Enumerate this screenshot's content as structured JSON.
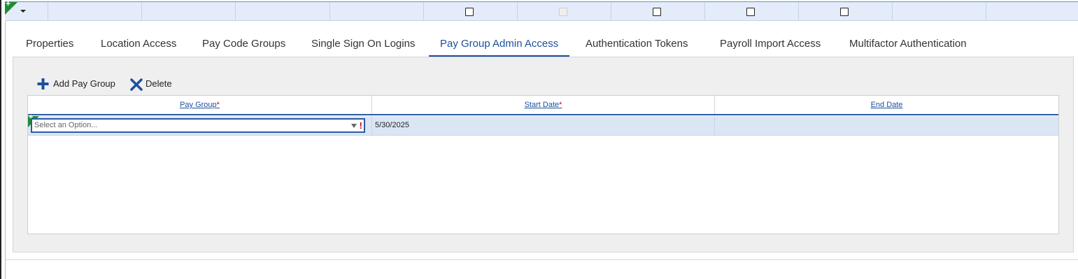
{
  "top_row": {
    "checkboxes": [
      {
        "checked": false,
        "disabled": false
      },
      {
        "checked": false,
        "disabled": true
      },
      {
        "checked": false,
        "disabled": false
      },
      {
        "checked": false,
        "disabled": false
      },
      {
        "checked": false,
        "disabled": false
      }
    ]
  },
  "tabs": [
    {
      "label": "Properties",
      "active": false
    },
    {
      "label": "Location Access",
      "active": false
    },
    {
      "label": "Pay Code Groups",
      "active": false
    },
    {
      "label": "Single Sign On Logins",
      "active": false
    },
    {
      "label": "Pay Group Admin Access",
      "active": true
    },
    {
      "label": "Authentication Tokens",
      "active": false
    },
    {
      "label": "Payroll Import Access",
      "active": false
    },
    {
      "label": "Multifactor Authentication",
      "active": false
    }
  ],
  "toolbar": {
    "add_label": "Add Pay Group",
    "delete_label": "Delete"
  },
  "grid": {
    "columns": [
      {
        "label": "Pay Group",
        "required_mark": "*"
      },
      {
        "label": "Start Date",
        "required_mark": "*"
      },
      {
        "label": "End Date",
        "required_mark": ""
      }
    ],
    "rows": [
      {
        "pay_group_placeholder": "Select an Option...",
        "pay_group_warning": "!",
        "start_date": "5/30/2025",
        "end_date": ""
      }
    ]
  },
  "colors": {
    "accent": "#1c4f9c",
    "new_row_flag": "#1f8b34",
    "required": "#d0021b"
  }
}
